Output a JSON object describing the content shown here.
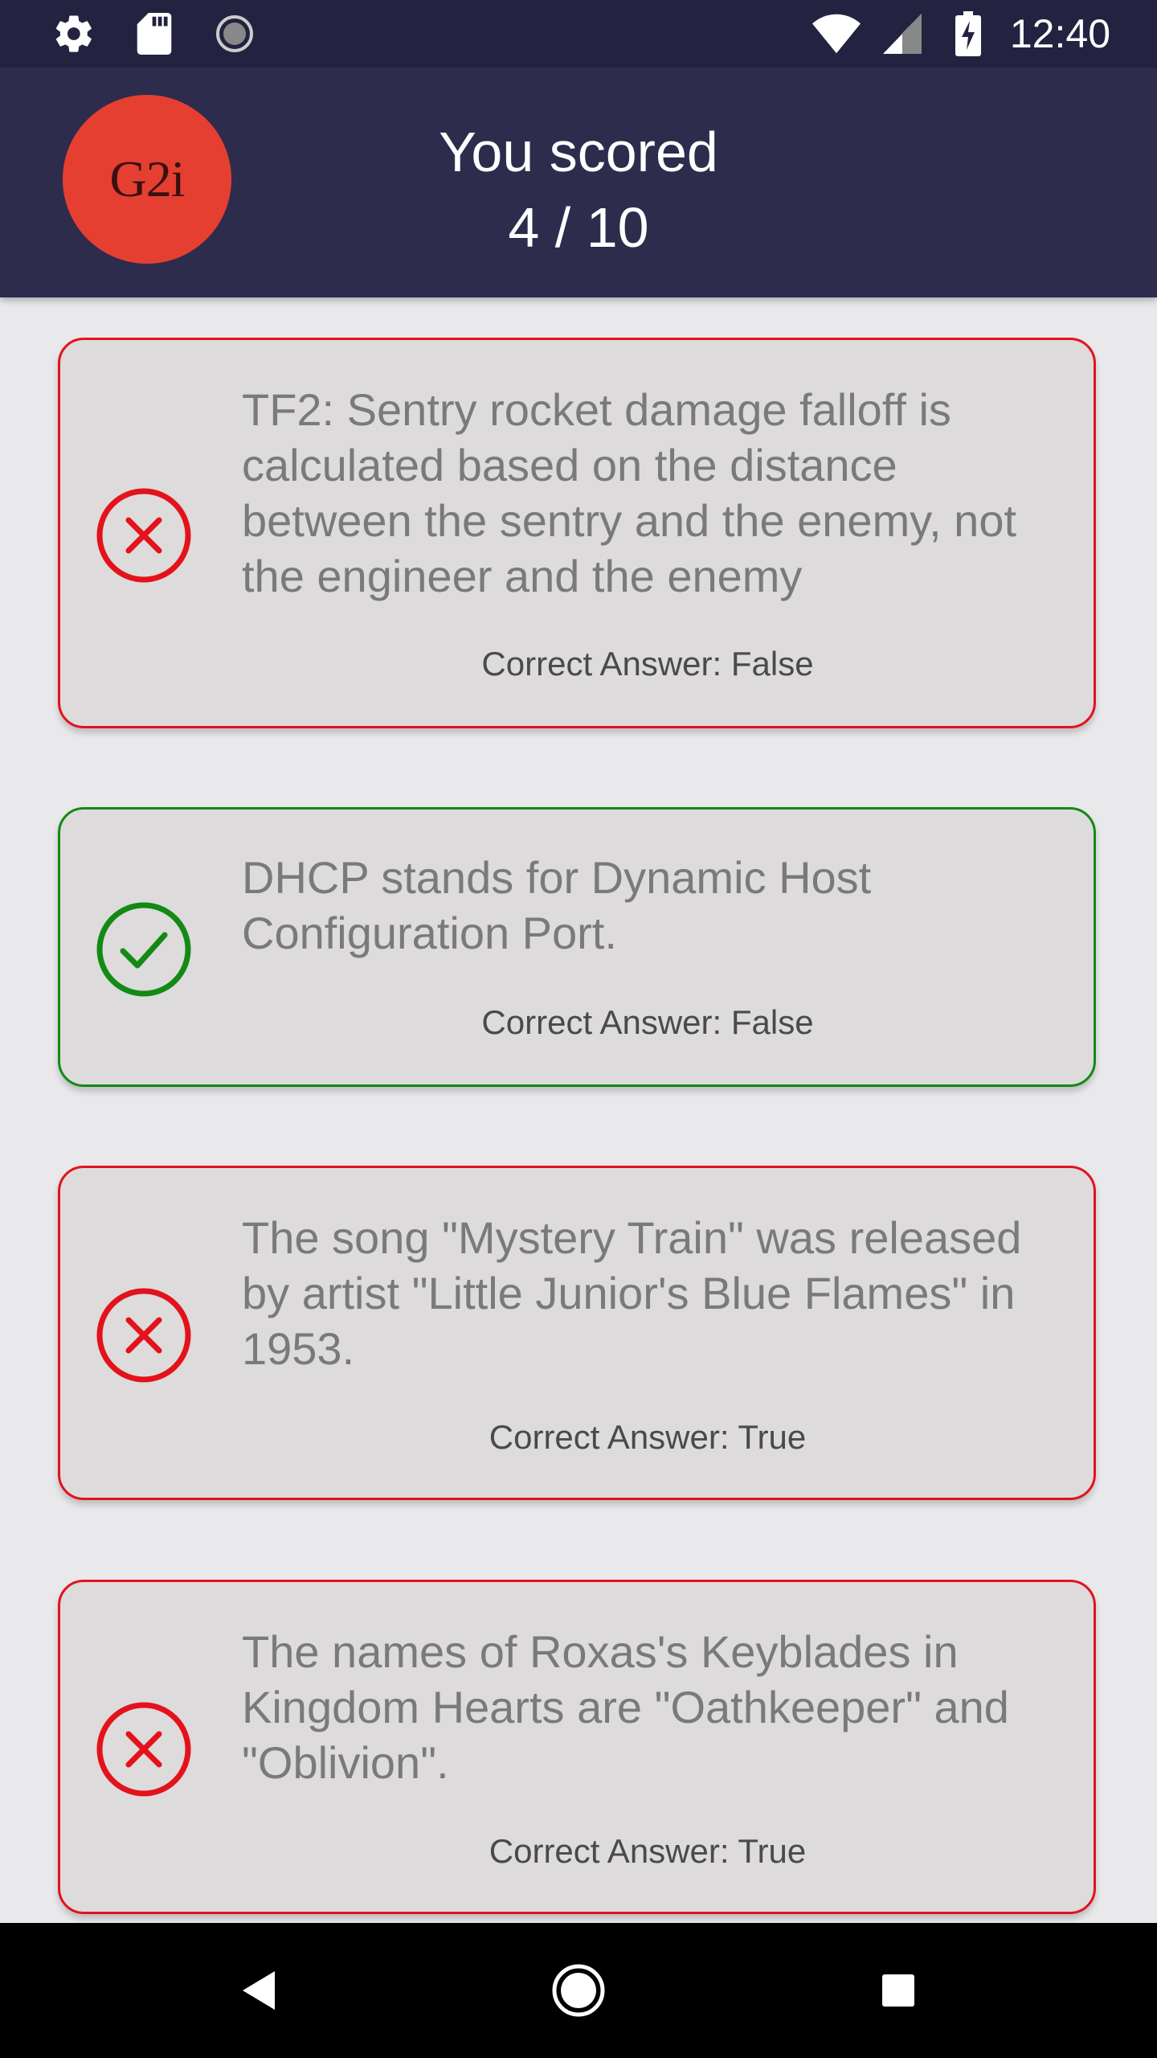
{
  "status_bar": {
    "time": "12:40",
    "left_icons": [
      "gear-icon",
      "sd-card-icon",
      "sync-icon"
    ],
    "right_icons": [
      "wifi-icon",
      "signal-icon",
      "battery-charging-icon"
    ]
  },
  "header": {
    "logo_text": "G2i",
    "score_label": "You scored",
    "score_value": "4 / 10"
  },
  "colors": {
    "wrong": "#e4121b",
    "correct": "#138a13",
    "logo": "#e53f32",
    "header": "#2d2c4c"
  },
  "results": [
    {
      "status": "wrong",
      "icon": "x-circle-icon",
      "question": "TF2: Sentry rocket damage falloff is calculated based on the distance between the sentry and the enemy, not the engineer and the enemy",
      "answer": "Correct Answer: False"
    },
    {
      "status": "correct",
      "icon": "check-circle-icon",
      "question": "DHCP stands for Dynamic Host Configuration Port.",
      "answer": "Correct Answer: False"
    },
    {
      "status": "wrong",
      "icon": "x-circle-icon",
      "question": "The song \"Mystery Train\" was released by artist \"Little Junior's Blue Flames\" in 1953.",
      "answer": "Correct Answer: True"
    },
    {
      "status": "wrong",
      "icon": "x-circle-icon",
      "question": "The names of Roxas's Keyblades in Kingdom Hearts are \"Oathkeeper\" and \"Oblivion\".",
      "answer": "Correct Answer: True"
    }
  ],
  "nav_bar": {
    "buttons": [
      "back-icon",
      "home-icon",
      "recents-icon"
    ]
  }
}
